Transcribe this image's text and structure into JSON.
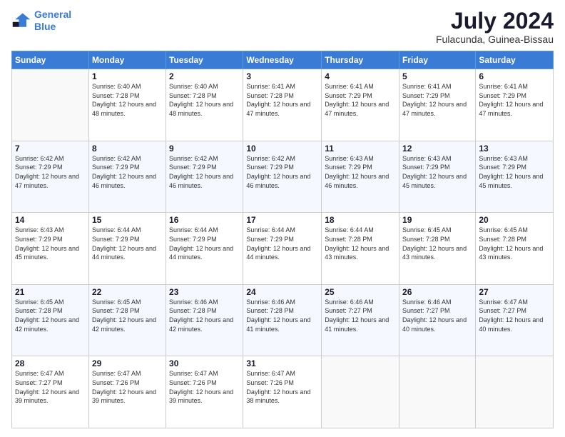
{
  "logo": {
    "line1": "General",
    "line2": "Blue"
  },
  "header": {
    "title": "July 2024",
    "subtitle": "Fulacunda, Guinea-Bissau"
  },
  "days_of_week": [
    "Sunday",
    "Monday",
    "Tuesday",
    "Wednesday",
    "Thursday",
    "Friday",
    "Saturday"
  ],
  "weeks": [
    [
      {
        "day": "",
        "sunrise": "",
        "sunset": "",
        "daylight": ""
      },
      {
        "day": "1",
        "sunrise": "6:40 AM",
        "sunset": "7:28 PM",
        "daylight": "12 hours and 48 minutes."
      },
      {
        "day": "2",
        "sunrise": "6:40 AM",
        "sunset": "7:28 PM",
        "daylight": "12 hours and 48 minutes."
      },
      {
        "day": "3",
        "sunrise": "6:41 AM",
        "sunset": "7:28 PM",
        "daylight": "12 hours and 47 minutes."
      },
      {
        "day": "4",
        "sunrise": "6:41 AM",
        "sunset": "7:29 PM",
        "daylight": "12 hours and 47 minutes."
      },
      {
        "day": "5",
        "sunrise": "6:41 AM",
        "sunset": "7:29 PM",
        "daylight": "12 hours and 47 minutes."
      },
      {
        "day": "6",
        "sunrise": "6:41 AM",
        "sunset": "7:29 PM",
        "daylight": "12 hours and 47 minutes."
      }
    ],
    [
      {
        "day": "7",
        "sunrise": "6:42 AM",
        "sunset": "7:29 PM",
        "daylight": "12 hours and 47 minutes."
      },
      {
        "day": "8",
        "sunrise": "6:42 AM",
        "sunset": "7:29 PM",
        "daylight": "12 hours and 46 minutes."
      },
      {
        "day": "9",
        "sunrise": "6:42 AM",
        "sunset": "7:29 PM",
        "daylight": "12 hours and 46 minutes."
      },
      {
        "day": "10",
        "sunrise": "6:42 AM",
        "sunset": "7:29 PM",
        "daylight": "12 hours and 46 minutes."
      },
      {
        "day": "11",
        "sunrise": "6:43 AM",
        "sunset": "7:29 PM",
        "daylight": "12 hours and 46 minutes."
      },
      {
        "day": "12",
        "sunrise": "6:43 AM",
        "sunset": "7:29 PM",
        "daylight": "12 hours and 45 minutes."
      },
      {
        "day": "13",
        "sunrise": "6:43 AM",
        "sunset": "7:29 PM",
        "daylight": "12 hours and 45 minutes."
      }
    ],
    [
      {
        "day": "14",
        "sunrise": "6:43 AM",
        "sunset": "7:29 PM",
        "daylight": "12 hours and 45 minutes."
      },
      {
        "day": "15",
        "sunrise": "6:44 AM",
        "sunset": "7:29 PM",
        "daylight": "12 hours and 44 minutes."
      },
      {
        "day": "16",
        "sunrise": "6:44 AM",
        "sunset": "7:29 PM",
        "daylight": "12 hours and 44 minutes."
      },
      {
        "day": "17",
        "sunrise": "6:44 AM",
        "sunset": "7:29 PM",
        "daylight": "12 hours and 44 minutes."
      },
      {
        "day": "18",
        "sunrise": "6:44 AM",
        "sunset": "7:28 PM",
        "daylight": "12 hours and 43 minutes."
      },
      {
        "day": "19",
        "sunrise": "6:45 AM",
        "sunset": "7:28 PM",
        "daylight": "12 hours and 43 minutes."
      },
      {
        "day": "20",
        "sunrise": "6:45 AM",
        "sunset": "7:28 PM",
        "daylight": "12 hours and 43 minutes."
      }
    ],
    [
      {
        "day": "21",
        "sunrise": "6:45 AM",
        "sunset": "7:28 PM",
        "daylight": "12 hours and 42 minutes."
      },
      {
        "day": "22",
        "sunrise": "6:45 AM",
        "sunset": "7:28 PM",
        "daylight": "12 hours and 42 minutes."
      },
      {
        "day": "23",
        "sunrise": "6:46 AM",
        "sunset": "7:28 PM",
        "daylight": "12 hours and 42 minutes."
      },
      {
        "day": "24",
        "sunrise": "6:46 AM",
        "sunset": "7:28 PM",
        "daylight": "12 hours and 41 minutes."
      },
      {
        "day": "25",
        "sunrise": "6:46 AM",
        "sunset": "7:27 PM",
        "daylight": "12 hours and 41 minutes."
      },
      {
        "day": "26",
        "sunrise": "6:46 AM",
        "sunset": "7:27 PM",
        "daylight": "12 hours and 40 minutes."
      },
      {
        "day": "27",
        "sunrise": "6:47 AM",
        "sunset": "7:27 PM",
        "daylight": "12 hours and 40 minutes."
      }
    ],
    [
      {
        "day": "28",
        "sunrise": "6:47 AM",
        "sunset": "7:27 PM",
        "daylight": "12 hours and 39 minutes."
      },
      {
        "day": "29",
        "sunrise": "6:47 AM",
        "sunset": "7:26 PM",
        "daylight": "12 hours and 39 minutes."
      },
      {
        "day": "30",
        "sunrise": "6:47 AM",
        "sunset": "7:26 PM",
        "daylight": "12 hours and 39 minutes."
      },
      {
        "day": "31",
        "sunrise": "6:47 AM",
        "sunset": "7:26 PM",
        "daylight": "12 hours and 38 minutes."
      },
      {
        "day": "",
        "sunrise": "",
        "sunset": "",
        "daylight": ""
      },
      {
        "day": "",
        "sunrise": "",
        "sunset": "",
        "daylight": ""
      },
      {
        "day": "",
        "sunrise": "",
        "sunset": "",
        "daylight": ""
      }
    ]
  ]
}
